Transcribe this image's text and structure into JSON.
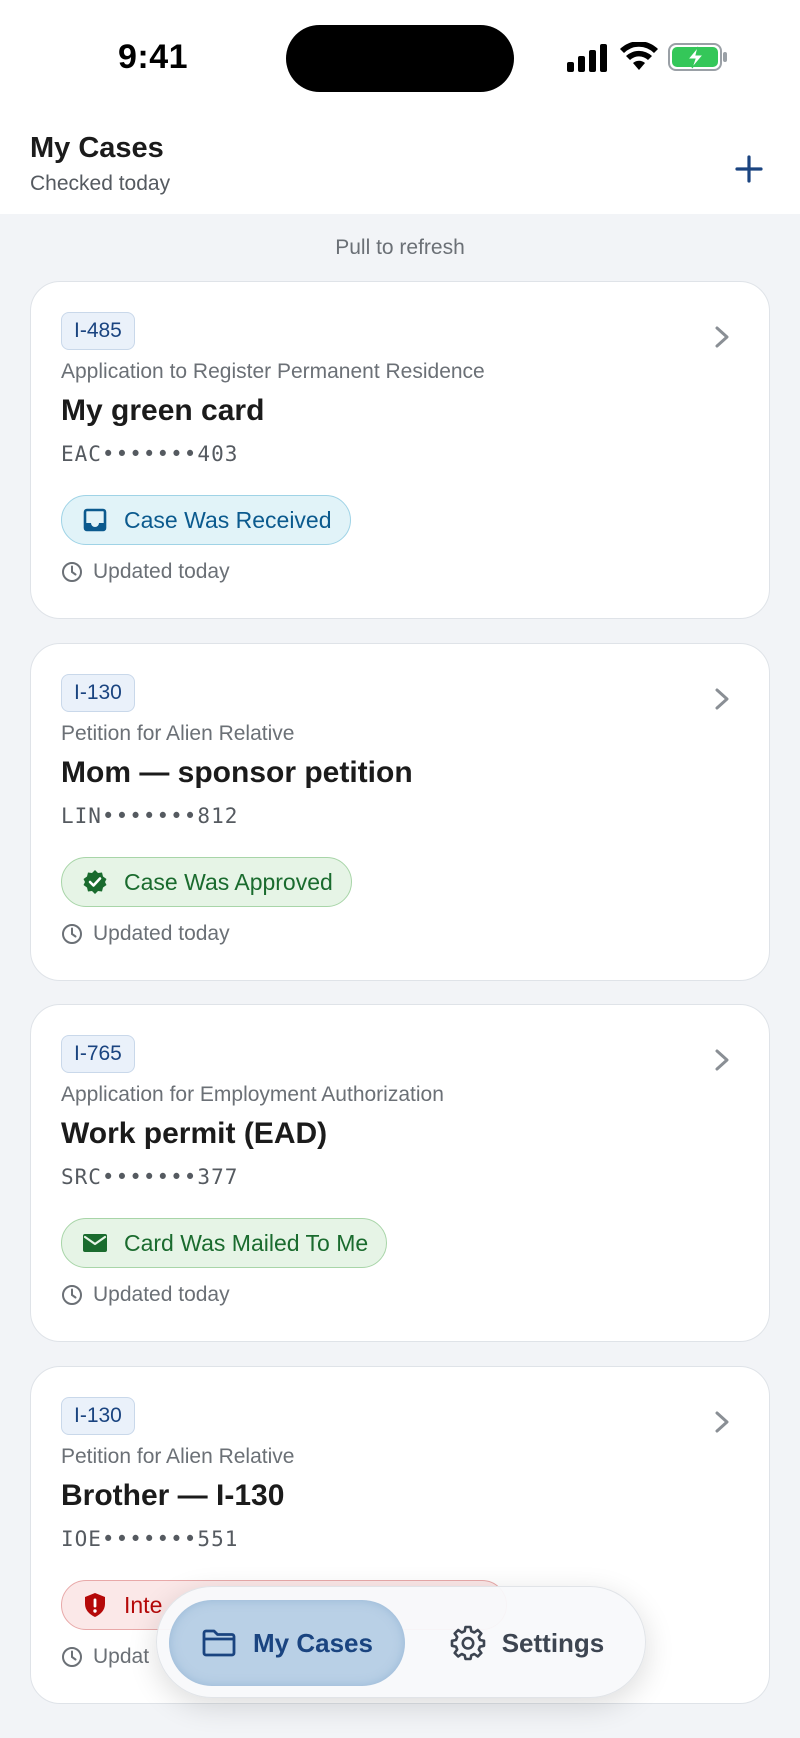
{
  "status_bar": {
    "time": "9:41"
  },
  "header": {
    "title": "My Cases",
    "subtitle": "Checked today",
    "add_icon": "plus-icon"
  },
  "pull_to_refresh": "Pull to refresh",
  "cases": [
    {
      "form": "I-485",
      "form_name": "Application to Register Permanent Residence",
      "name": "My green card",
      "receipt": "EAC•••••••403",
      "status": "Case Was Received",
      "status_icon": "inbox-icon",
      "status_color": "#0b5a8e",
      "updated": "Updated today"
    },
    {
      "form": "I-130",
      "form_name": "Petition for Alien Relative",
      "name": "Mom — sponsor petition",
      "receipt": "LIN•••••••812",
      "status": "Case Was Approved",
      "status_icon": "verified-check-icon",
      "status_color": "#1a6b2e",
      "updated": "Updated today"
    },
    {
      "form": "I-765",
      "form_name": "Application for Employment Authorization",
      "name": "Work permit (EAD)",
      "receipt": "SRC•••••••377",
      "status": "Card Was Mailed To Me",
      "status_icon": "envelope-icon",
      "status_color": "#1a6b2e",
      "updated": "Updated today"
    },
    {
      "form": "I-130",
      "form_name": "Petition for Alien Relative",
      "name": "Brother — I-130",
      "receipt": "IOE•••••••551",
      "status": "Inte",
      "status_icon": "shield-alert-icon",
      "status_color": "#b50909",
      "updated": "Updat"
    }
  ],
  "tabbar": {
    "tabs": [
      {
        "label": "My Cases",
        "icon": "folder-icon",
        "selected": true
      },
      {
        "label": "Settings",
        "icon": "gear-icon",
        "selected": false
      }
    ]
  }
}
